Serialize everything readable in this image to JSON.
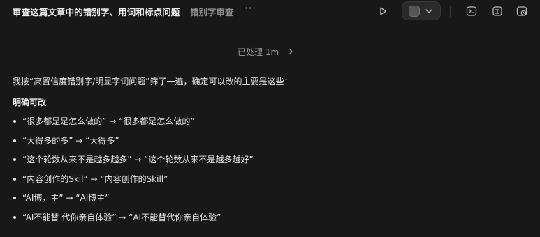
{
  "header": {
    "title": "审查这篇文章中的错别字、用词和标点问题",
    "subtitle": "错别字审查",
    "more_label": "···"
  },
  "divider": {
    "label": "已处理 1m"
  },
  "message": {
    "intro": "我按“高置信度错别字/明显字词问题”筛了一遍，确定可以改的主要是这些：",
    "section_title": "明确可改",
    "fixes": [
      "“很多都是是怎么做的” → “很多都是怎么做的”",
      "“大得多的多” → “大得多”",
      "“这个轮数从来不是越多越多” → “这个轮数从来不是越多越好”",
      "“内容创作的Skil” → “内容创作的Skill”",
      "“AI博，主” → “AI博主”",
      "“AI不能替 代你亲自体验” → “AI不能替代你亲自体验”"
    ]
  },
  "icons": {
    "play": "play-icon",
    "model": "model-selector-icon",
    "terminal": "terminal-icon",
    "box": "box-icon",
    "window": "window-icon"
  }
}
